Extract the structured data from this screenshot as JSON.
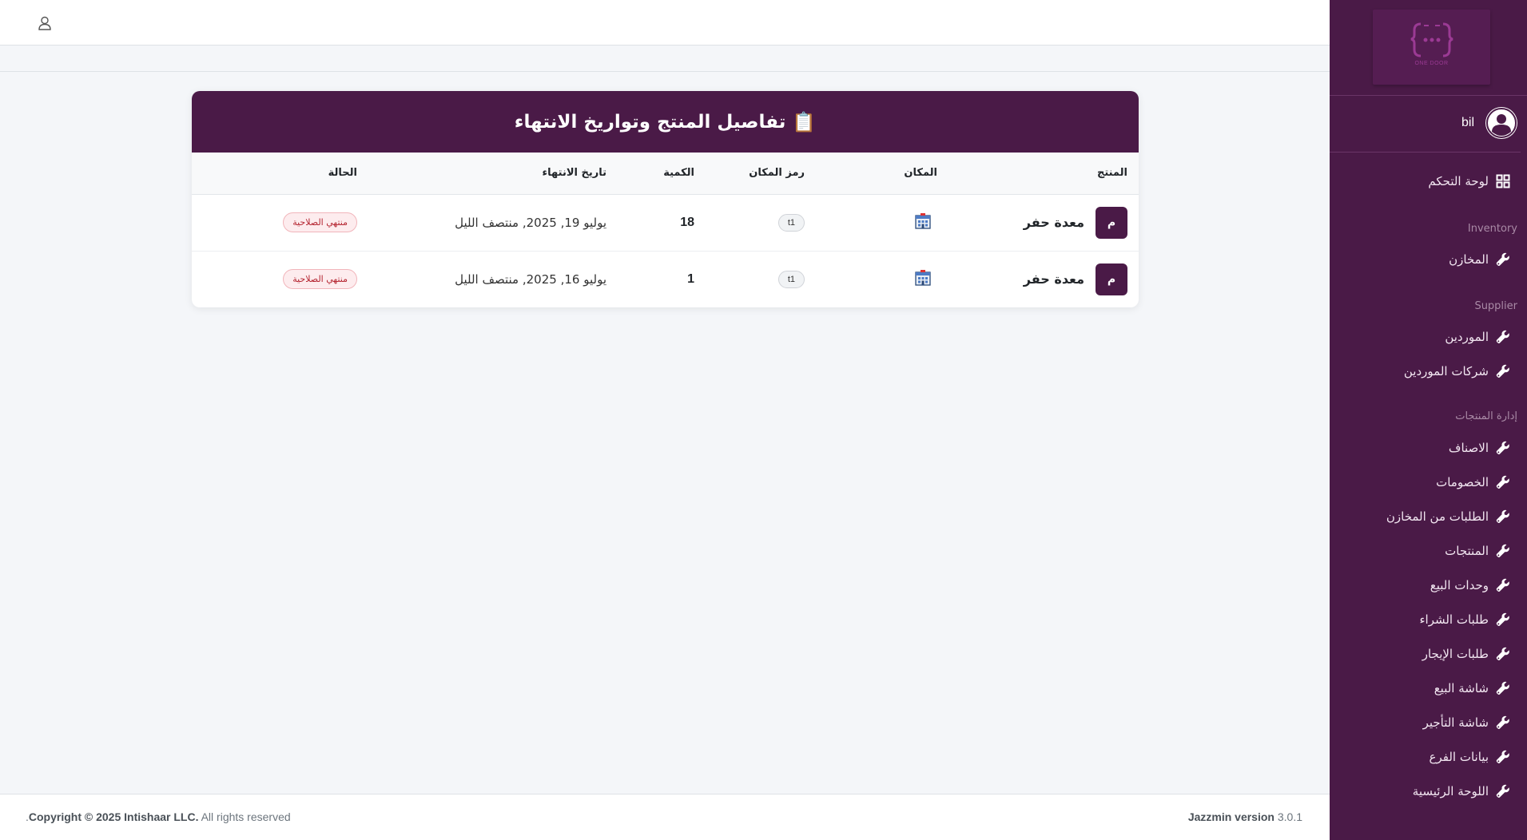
{
  "sidebar": {
    "brand_caption": "ONE DOOR",
    "user_name": "bil",
    "dashboard_label": "لوحة التحكم",
    "sections": [
      {
        "header": "Inventory",
        "items": [
          "المخازن"
        ]
      },
      {
        "header": "Supplier",
        "items": [
          "الموردين",
          "شركات الموردين"
        ]
      },
      {
        "header": "إدارة المنتجات",
        "items": [
          "الاصناف",
          "الخصومات",
          "الطلبات من المخازن",
          "المنتجات",
          "وحدات البيع",
          "طلبات الشراء",
          "طلبات الإيجار",
          "شاشة البيع",
          "شاشة التأجير",
          "بيانات الفرع",
          "اللوحة الرئيسية"
        ]
      }
    ]
  },
  "card": {
    "title": "تفاصيل المنتج وتواريخ الانتهاء",
    "title_icon": "📋",
    "columns": [
      "المنتج",
      "المكان",
      "رمز المكان",
      "الكمية",
      "تاريخ الانتهاء",
      "الحالة"
    ],
    "rows": [
      {
        "badge": "م",
        "product": "معدة حفر",
        "location_icon": "building-icon",
        "location_code": "t1",
        "quantity": "18",
        "expiry": "يوليو 19, 2025, منتصف الليل",
        "status": "منتهي الصلاحية"
      },
      {
        "badge": "م",
        "product": "معدة حفر",
        "location_icon": "building-icon",
        "location_code": "t1",
        "quantity": "1",
        "expiry": "يوليو 16, 2025, منتصف الليل",
        "status": "منتهي الصلاحية"
      }
    ]
  },
  "footer": {
    "copyright_bold": "Copyright © 2025 Intishaar LLC.",
    "copyright_rest": "All rights reserved",
    "copyright_dot": ".",
    "version_label": "Jazzmin version",
    "version_number": "3.0.1"
  },
  "colors": {
    "primary": "#4a1a47",
    "status_red": "#b4232f"
  }
}
